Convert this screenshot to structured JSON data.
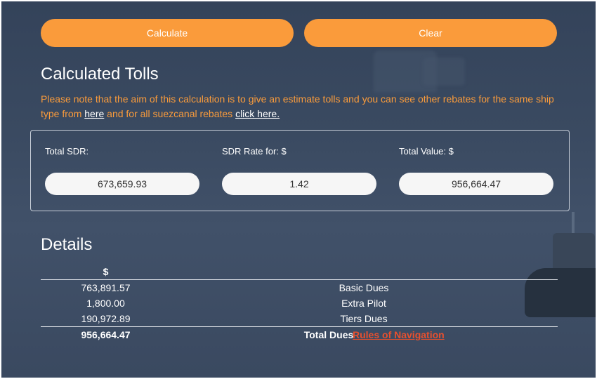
{
  "actions": {
    "calculate_label": "Calculate",
    "clear_label": "Clear"
  },
  "tolls": {
    "title": "Calculated Tolls",
    "note_prefix": "Please note that the aim of this calculation is to give an estimate tolls and you can see other rebates for the same ship type from ",
    "note_link1": "here",
    "note_middle": " and for all suezcanal rebates ",
    "note_link2": "click here.",
    "total_sdr_label": "Total SDR:",
    "total_sdr_value": "673,659.93",
    "sdr_rate_label": "SDR Rate for: $",
    "sdr_rate_value": "1.42",
    "total_value_label": "Total Value: $",
    "total_value_value": "956,664.47"
  },
  "details": {
    "title": "Details",
    "currency_header": "$",
    "rows": [
      {
        "amount": "763,891.57",
        "name": "Basic Dues"
      },
      {
        "amount": "1,800.00",
        "name": "Extra Pilot"
      },
      {
        "amount": "190,972.89",
        "name": "Tiers Dues"
      }
    ],
    "total_amount": "956,664.47",
    "total_label": "Total Dues",
    "rules_link": "Rules of Navigation"
  },
  "colors": {
    "accent": "#fa9b3b",
    "link_red": "#e8502e",
    "background": "#3a4960"
  }
}
